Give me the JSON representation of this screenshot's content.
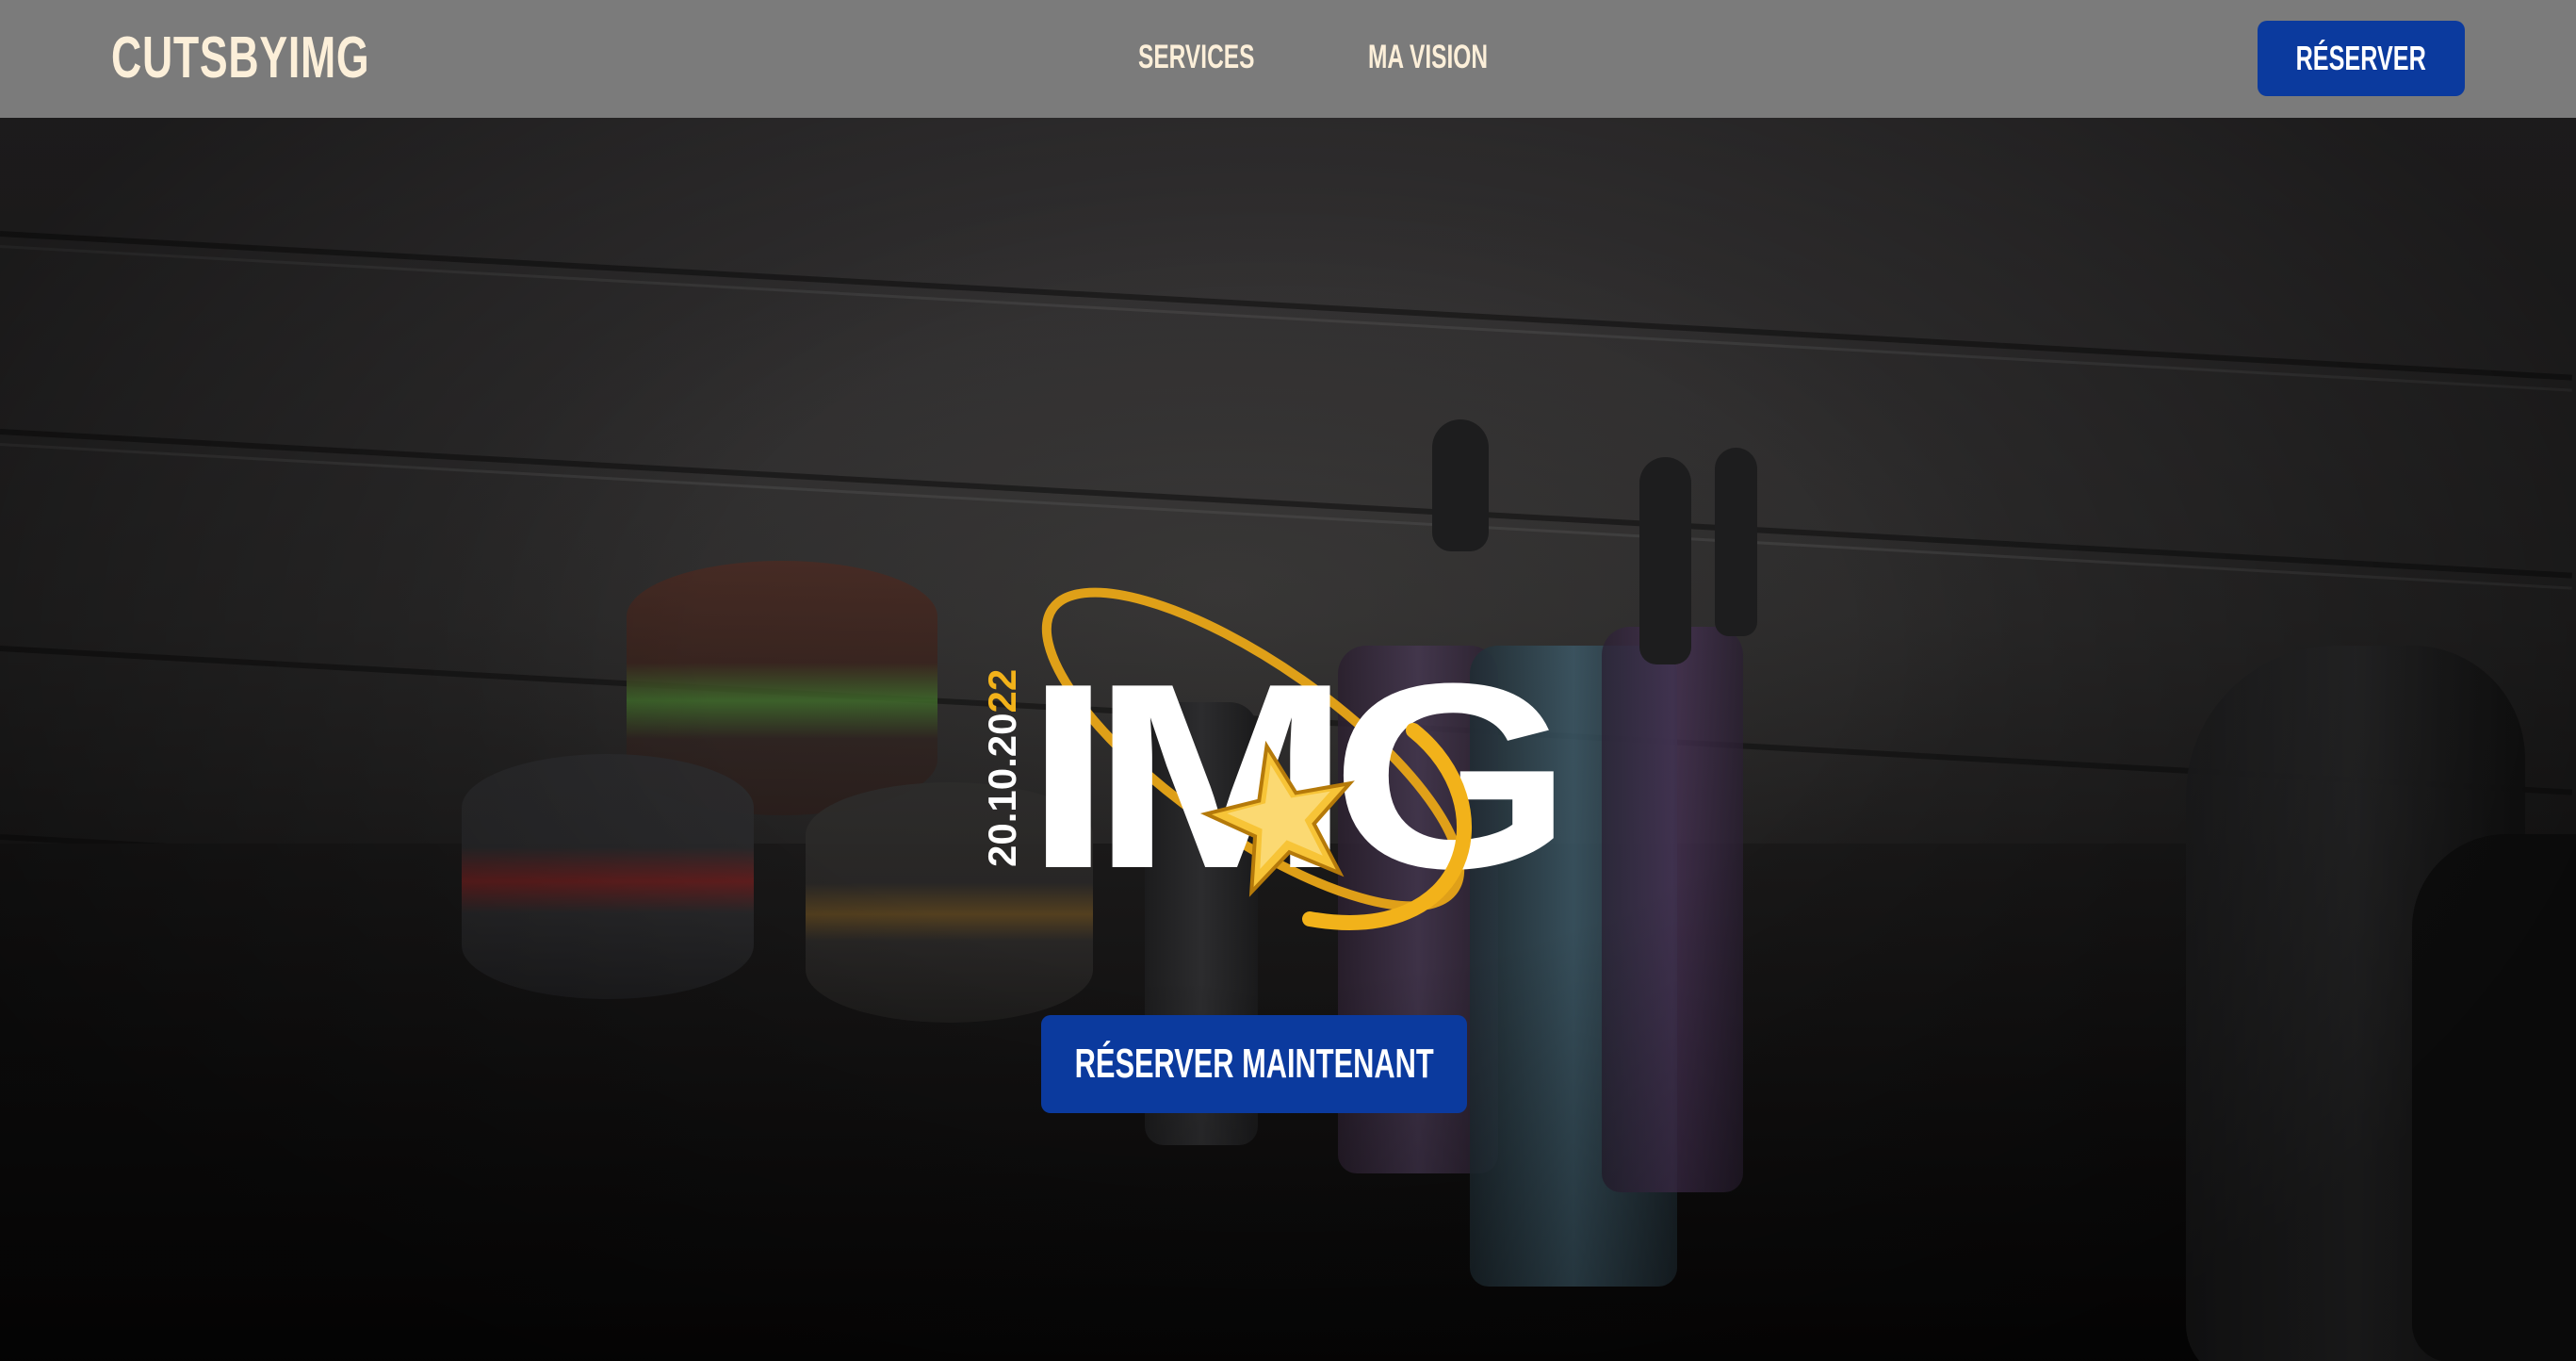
{
  "header": {
    "brand": "CUTSBYIMG",
    "nav": [
      {
        "label": "SERVICES"
      },
      {
        "label": "MA VISION"
      }
    ],
    "cta_label": "RÉSERVER"
  },
  "hero": {
    "logo": {
      "wordmark": "IMG",
      "date_white": "20.10.20",
      "date_gold": "22"
    },
    "cta_label": "RÉSERVER MAINTENANT"
  },
  "colors": {
    "header_bg": "#7b7b7b",
    "brand_text": "#fcefd9",
    "button_blue": "#0b3a9e",
    "logo_gold": "#f2b21a"
  }
}
